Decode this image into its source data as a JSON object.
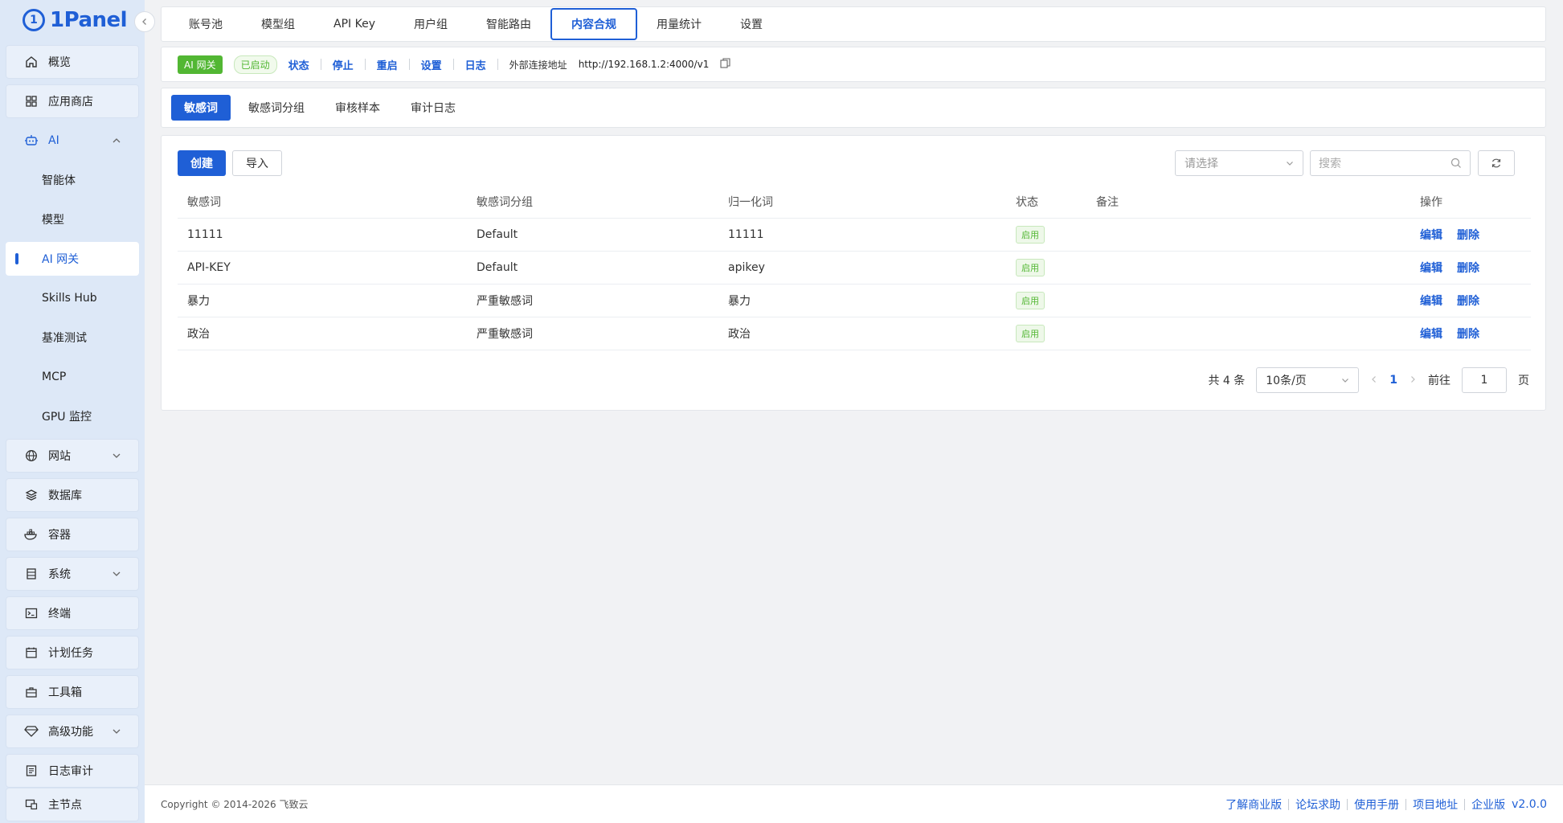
{
  "app": {
    "logo_text": "1Panel",
    "logo_mark": "1"
  },
  "sidebar": {
    "items": [
      {
        "label": "概览",
        "icon": "home-icon"
      },
      {
        "label": "应用商店",
        "icon": "grid-icon"
      },
      {
        "label": "AI",
        "icon": "robot-icon"
      },
      {
        "label": "网站",
        "icon": "globe-icon"
      },
      {
        "label": "数据库",
        "icon": "layers-icon"
      },
      {
        "label": "容器",
        "icon": "docker-icon"
      },
      {
        "label": "系统",
        "icon": "server-icon"
      },
      {
        "label": "终端",
        "icon": "terminal-icon"
      },
      {
        "label": "计划任务",
        "icon": "calendar-icon"
      },
      {
        "label": "工具箱",
        "icon": "toolbox-icon"
      },
      {
        "label": "高级功能",
        "icon": "diamond-icon"
      },
      {
        "label": "日志审计",
        "icon": "log-icon"
      },
      {
        "label": "主节点",
        "icon": "node-icon"
      }
    ],
    "ai_sub": [
      "智能体",
      "模型",
      "AI 网关",
      "Skills Hub",
      "基准测试",
      "MCP",
      "GPU 监控"
    ]
  },
  "top_tabs": [
    "账号池",
    "模型组",
    "API Key",
    "用户组",
    "智能路由",
    "内容合规",
    "用量统计",
    "设置"
  ],
  "status_bar": {
    "app_tag": "AI 网关",
    "state_tag": "已启动",
    "actions": [
      "状态",
      "停止",
      "重启",
      "设置",
      "日志"
    ],
    "addr_label": "外部连接地址",
    "addr": "http://192.168.1.2:4000/v1"
  },
  "sub_tabs": [
    "敏感词",
    "敏感词分组",
    "审核样本",
    "审计日志"
  ],
  "toolbar": {
    "create": "创建",
    "import": "导入",
    "select_placeholder": "请选择",
    "search_placeholder": "搜索"
  },
  "table": {
    "columns": [
      "敏感词",
      "敏感词分组",
      "归一化词",
      "状态",
      "备注",
      "操作"
    ],
    "rows": [
      {
        "word": "11111",
        "group": "Default",
        "normalized": "11111",
        "status": "启用",
        "note": ""
      },
      {
        "word": "API-KEY",
        "group": "Default",
        "normalized": "apikey",
        "status": "启用",
        "note": ""
      },
      {
        "word": "暴力",
        "group": "严重敏感词",
        "normalized": "暴力",
        "status": "启用",
        "note": ""
      },
      {
        "word": "政治",
        "group": "严重敏感词",
        "normalized": "政治",
        "status": "启用",
        "note": ""
      }
    ],
    "op_edit": "编辑",
    "op_delete": "删除"
  },
  "pager": {
    "total": "共 4 条",
    "page_size": "10条/页",
    "page": "1",
    "goto_label": "前往",
    "goto_value": "1",
    "page_suffix": "页"
  },
  "footer": {
    "copyright": "Copyright © 2014-2026 飞致云",
    "links": [
      "了解商业版",
      "论坛求助",
      "使用手册",
      "项目地址",
      "企业版"
    ],
    "version": "v2.0.0"
  },
  "colors": {
    "accent": "#1f5fd6",
    "success": "#52b733",
    "sidebar_bg": "#dde8f7"
  }
}
